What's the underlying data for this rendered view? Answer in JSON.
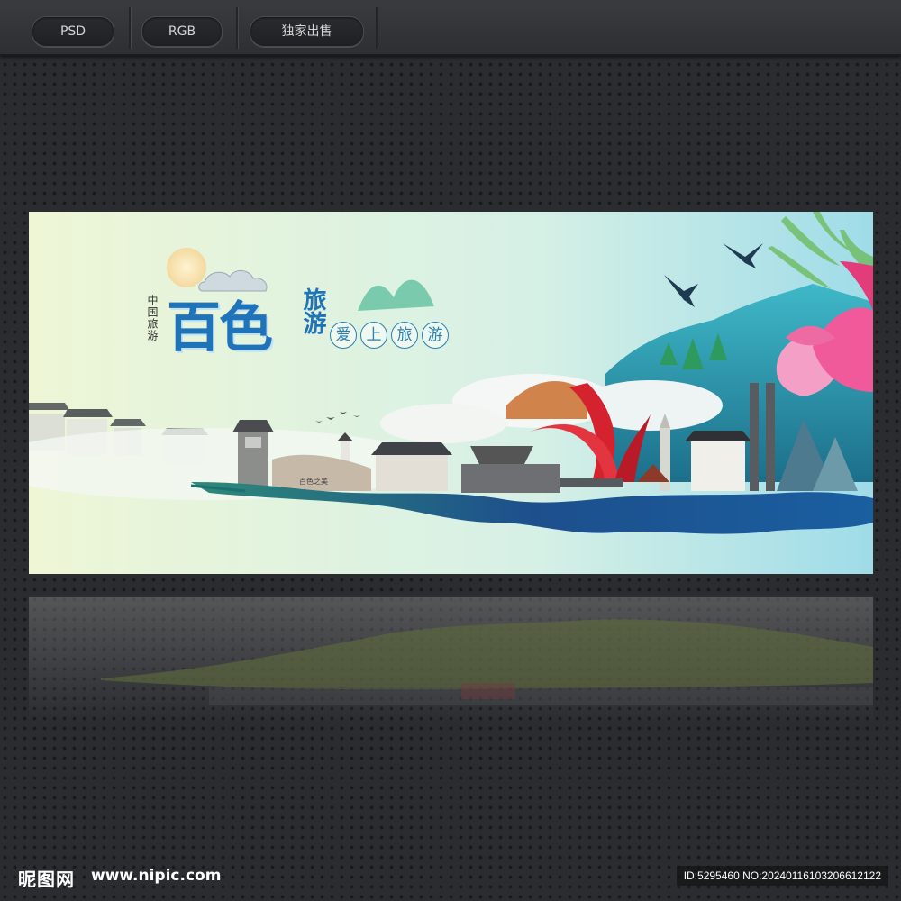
{
  "toolbar": {
    "format_badge": "PSD",
    "color_mode_badge": "RGB",
    "license_badge": "独家出售"
  },
  "banner": {
    "side_text": "中国旅游",
    "main_title": "百色",
    "title_suffix": "旅游",
    "slogan_chars": [
      "爱",
      "上",
      "旅",
      "游"
    ],
    "stone_label": "百色之美"
  },
  "footer": {
    "site_logo": "昵图网",
    "site_url": "www.nipic.com",
    "image_id": "ID:5295460 NO:20240116103206612122"
  },
  "colors": {
    "title_blue": "#1f73b8",
    "slogan_teal": "#2b7fb0",
    "sculpture_red": "#d4232f",
    "lotus_pink": "#f05a9a",
    "ink_teal": "#1e6f73",
    "ink_blue": "#1d4f8c"
  }
}
